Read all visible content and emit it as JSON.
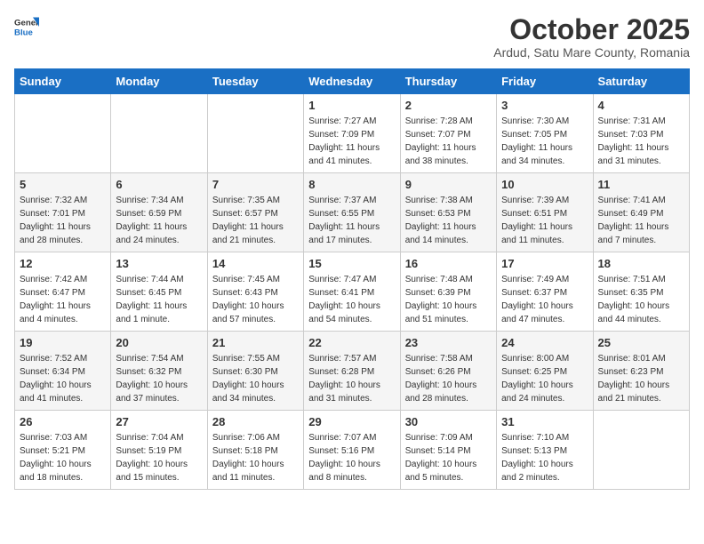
{
  "logo": {
    "general": "General",
    "blue": "Blue"
  },
  "header": {
    "title": "October 2025",
    "subtitle": "Ardud, Satu Mare County, Romania"
  },
  "weekdays": [
    "Sunday",
    "Monday",
    "Tuesday",
    "Wednesday",
    "Thursday",
    "Friday",
    "Saturday"
  ],
  "weeks": [
    [
      {
        "day": "",
        "sunrise": "",
        "sunset": "",
        "daylight": ""
      },
      {
        "day": "",
        "sunrise": "",
        "sunset": "",
        "daylight": ""
      },
      {
        "day": "",
        "sunrise": "",
        "sunset": "",
        "daylight": ""
      },
      {
        "day": "1",
        "sunrise": "Sunrise: 7:27 AM",
        "sunset": "Sunset: 7:09 PM",
        "daylight": "Daylight: 11 hours and 41 minutes."
      },
      {
        "day": "2",
        "sunrise": "Sunrise: 7:28 AM",
        "sunset": "Sunset: 7:07 PM",
        "daylight": "Daylight: 11 hours and 38 minutes."
      },
      {
        "day": "3",
        "sunrise": "Sunrise: 7:30 AM",
        "sunset": "Sunset: 7:05 PM",
        "daylight": "Daylight: 11 hours and 34 minutes."
      },
      {
        "day": "4",
        "sunrise": "Sunrise: 7:31 AM",
        "sunset": "Sunset: 7:03 PM",
        "daylight": "Daylight: 11 hours and 31 minutes."
      }
    ],
    [
      {
        "day": "5",
        "sunrise": "Sunrise: 7:32 AM",
        "sunset": "Sunset: 7:01 PM",
        "daylight": "Daylight: 11 hours and 28 minutes."
      },
      {
        "day": "6",
        "sunrise": "Sunrise: 7:34 AM",
        "sunset": "Sunset: 6:59 PM",
        "daylight": "Daylight: 11 hours and 24 minutes."
      },
      {
        "day": "7",
        "sunrise": "Sunrise: 7:35 AM",
        "sunset": "Sunset: 6:57 PM",
        "daylight": "Daylight: 11 hours and 21 minutes."
      },
      {
        "day": "8",
        "sunrise": "Sunrise: 7:37 AM",
        "sunset": "Sunset: 6:55 PM",
        "daylight": "Daylight: 11 hours and 17 minutes."
      },
      {
        "day": "9",
        "sunrise": "Sunrise: 7:38 AM",
        "sunset": "Sunset: 6:53 PM",
        "daylight": "Daylight: 11 hours and 14 minutes."
      },
      {
        "day": "10",
        "sunrise": "Sunrise: 7:39 AM",
        "sunset": "Sunset: 6:51 PM",
        "daylight": "Daylight: 11 hours and 11 minutes."
      },
      {
        "day": "11",
        "sunrise": "Sunrise: 7:41 AM",
        "sunset": "Sunset: 6:49 PM",
        "daylight": "Daylight: 11 hours and 7 minutes."
      }
    ],
    [
      {
        "day": "12",
        "sunrise": "Sunrise: 7:42 AM",
        "sunset": "Sunset: 6:47 PM",
        "daylight": "Daylight: 11 hours and 4 minutes."
      },
      {
        "day": "13",
        "sunrise": "Sunrise: 7:44 AM",
        "sunset": "Sunset: 6:45 PM",
        "daylight": "Daylight: 11 hours and 1 minute."
      },
      {
        "day": "14",
        "sunrise": "Sunrise: 7:45 AM",
        "sunset": "Sunset: 6:43 PM",
        "daylight": "Daylight: 10 hours and 57 minutes."
      },
      {
        "day": "15",
        "sunrise": "Sunrise: 7:47 AM",
        "sunset": "Sunset: 6:41 PM",
        "daylight": "Daylight: 10 hours and 54 minutes."
      },
      {
        "day": "16",
        "sunrise": "Sunrise: 7:48 AM",
        "sunset": "Sunset: 6:39 PM",
        "daylight": "Daylight: 10 hours and 51 minutes."
      },
      {
        "day": "17",
        "sunrise": "Sunrise: 7:49 AM",
        "sunset": "Sunset: 6:37 PM",
        "daylight": "Daylight: 10 hours and 47 minutes."
      },
      {
        "day": "18",
        "sunrise": "Sunrise: 7:51 AM",
        "sunset": "Sunset: 6:35 PM",
        "daylight": "Daylight: 10 hours and 44 minutes."
      }
    ],
    [
      {
        "day": "19",
        "sunrise": "Sunrise: 7:52 AM",
        "sunset": "Sunset: 6:34 PM",
        "daylight": "Daylight: 10 hours and 41 minutes."
      },
      {
        "day": "20",
        "sunrise": "Sunrise: 7:54 AM",
        "sunset": "Sunset: 6:32 PM",
        "daylight": "Daylight: 10 hours and 37 minutes."
      },
      {
        "day": "21",
        "sunrise": "Sunrise: 7:55 AM",
        "sunset": "Sunset: 6:30 PM",
        "daylight": "Daylight: 10 hours and 34 minutes."
      },
      {
        "day": "22",
        "sunrise": "Sunrise: 7:57 AM",
        "sunset": "Sunset: 6:28 PM",
        "daylight": "Daylight: 10 hours and 31 minutes."
      },
      {
        "day": "23",
        "sunrise": "Sunrise: 7:58 AM",
        "sunset": "Sunset: 6:26 PM",
        "daylight": "Daylight: 10 hours and 28 minutes."
      },
      {
        "day": "24",
        "sunrise": "Sunrise: 8:00 AM",
        "sunset": "Sunset: 6:25 PM",
        "daylight": "Daylight: 10 hours and 24 minutes."
      },
      {
        "day": "25",
        "sunrise": "Sunrise: 8:01 AM",
        "sunset": "Sunset: 6:23 PM",
        "daylight": "Daylight: 10 hours and 21 minutes."
      }
    ],
    [
      {
        "day": "26",
        "sunrise": "Sunrise: 7:03 AM",
        "sunset": "Sunset: 5:21 PM",
        "daylight": "Daylight: 10 hours and 18 minutes."
      },
      {
        "day": "27",
        "sunrise": "Sunrise: 7:04 AM",
        "sunset": "Sunset: 5:19 PM",
        "daylight": "Daylight: 10 hours and 15 minutes."
      },
      {
        "day": "28",
        "sunrise": "Sunrise: 7:06 AM",
        "sunset": "Sunset: 5:18 PM",
        "daylight": "Daylight: 10 hours and 11 minutes."
      },
      {
        "day": "29",
        "sunrise": "Sunrise: 7:07 AM",
        "sunset": "Sunset: 5:16 PM",
        "daylight": "Daylight: 10 hours and 8 minutes."
      },
      {
        "day": "30",
        "sunrise": "Sunrise: 7:09 AM",
        "sunset": "Sunset: 5:14 PM",
        "daylight": "Daylight: 10 hours and 5 minutes."
      },
      {
        "day": "31",
        "sunrise": "Sunrise: 7:10 AM",
        "sunset": "Sunset: 5:13 PM",
        "daylight": "Daylight: 10 hours and 2 minutes."
      },
      {
        "day": "",
        "sunrise": "",
        "sunset": "",
        "daylight": ""
      }
    ]
  ]
}
